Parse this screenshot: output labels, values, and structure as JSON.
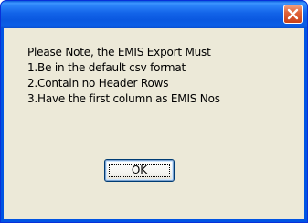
{
  "dialog": {
    "title": "",
    "close_icon": "close-icon",
    "message_lines": [
      "Please Note, the EMIS Export Must",
      "1.Be in the default csv format",
      "2.Contain no Header Rows",
      "3.Have the first column as EMIS Nos"
    ],
    "ok_label": "OK"
  },
  "colors": {
    "titlebar": "#0a58e0",
    "close_button": "#e0643a",
    "body": "#ece9d8"
  }
}
